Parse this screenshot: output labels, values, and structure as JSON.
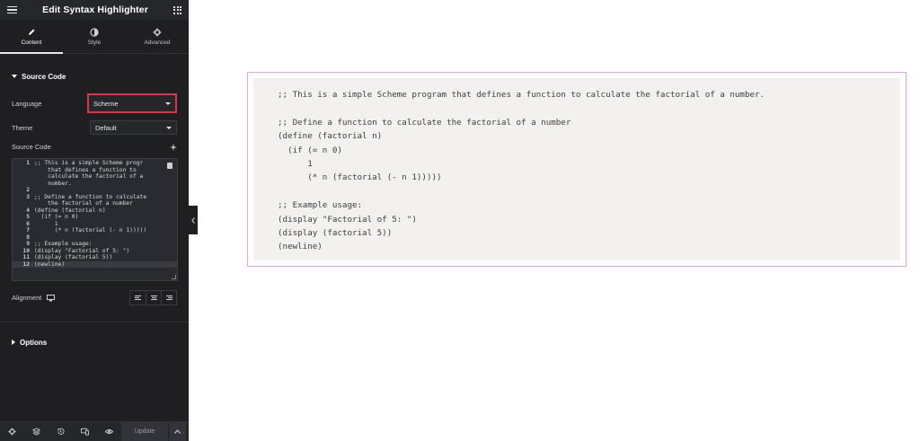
{
  "sidebar": {
    "title": "Edit Syntax Highlighter",
    "tabs": [
      {
        "label": "Content",
        "icon": "pencil-icon"
      },
      {
        "label": "Style",
        "icon": "half-circle-icon"
      },
      {
        "label": "Advanced",
        "icon": "gear-icon"
      }
    ],
    "source_section": "Source Code",
    "language_label": "Language",
    "language_value": "Scheme",
    "theme_label": "Theme",
    "theme_value": "Default",
    "source_code_label": "Source Code",
    "alignment_label": "Alignment",
    "options_section": "Options",
    "update_label": "Update"
  },
  "editor": {
    "lines": [
      {
        "n": "1",
        "t": ";; This is a simple Scheme progr"
      },
      {
        "n": "",
        "t": "    that defines a function to"
      },
      {
        "n": "",
        "t": "    calculate the factorial of a"
      },
      {
        "n": "",
        "t": "    number."
      },
      {
        "n": "2",
        "t": ""
      },
      {
        "n": "3",
        "t": ";; Define a function to calculate"
      },
      {
        "n": "",
        "t": "    the factorial of a number"
      },
      {
        "n": "4",
        "t": "(define (factorial n)"
      },
      {
        "n": "5",
        "t": "  (if (= n 0)"
      },
      {
        "n": "6",
        "t": "      1"
      },
      {
        "n": "7",
        "t": "      (* n (factorial (- n 1)))))"
      },
      {
        "n": "8",
        "t": ""
      },
      {
        "n": "9",
        "t": ";; Example usage:"
      },
      {
        "n": "10",
        "t": "(display \"Factorial of 5: \")"
      },
      {
        "n": "11",
        "t": "(display (factorial 5))"
      },
      {
        "n": "12",
        "t": "(newline)"
      }
    ]
  },
  "preview": {
    "lines": [
      ";; This is a simple Scheme program that defines a function to calculate the factorial of a number.",
      "",
      ";; Define a function to calculate the factorial of a number",
      "(define (factorial n)",
      "  (if (= n 0)",
      "      1",
      "      (* n (factorial (- n 1)))))",
      "",
      ";; Example usage:",
      "(display \"Factorial of 5: \")",
      "(display (factorial 5))",
      "(newline)"
    ]
  },
  "colors": {
    "sidebar_bg": "#1f1f22",
    "highlight_border": "#e0334a",
    "preview_border": "#eaa0ea",
    "preview_bg": "#f3f1ef"
  }
}
